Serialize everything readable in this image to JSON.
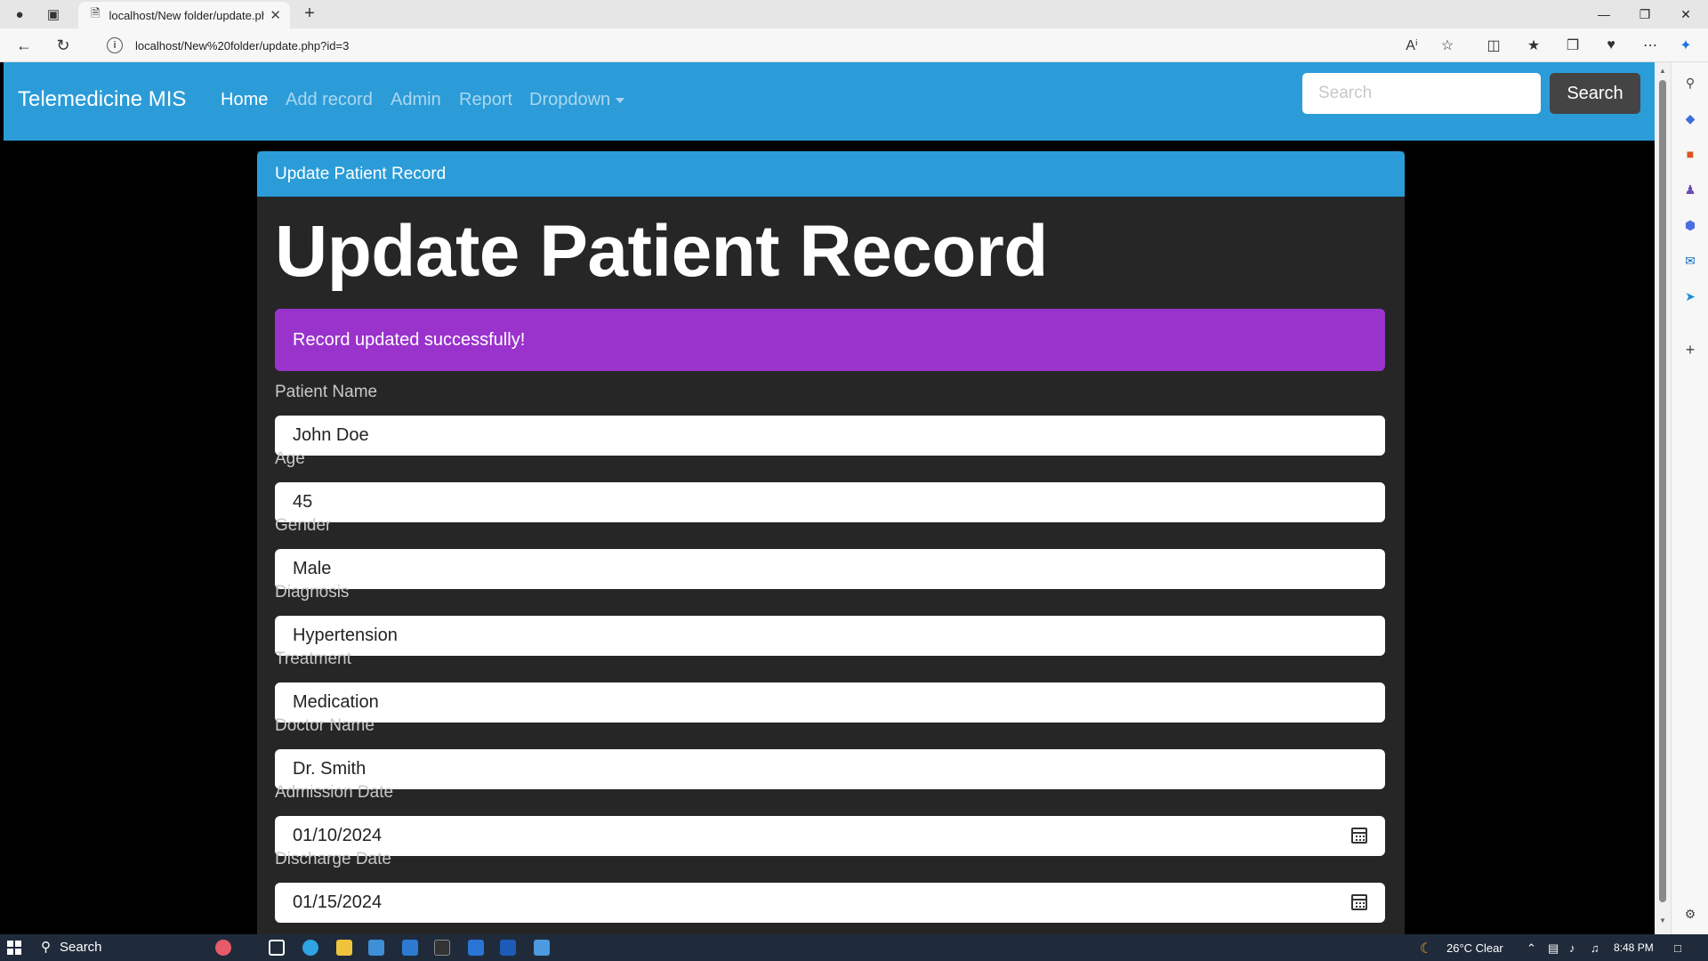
{
  "browser": {
    "tab_title": "localhost/New folder/update.php",
    "url": "localhost/New%20folder/update.php?id=3"
  },
  "navbar": {
    "brand": "Telemedicine MIS",
    "links": [
      "Home",
      "Add record",
      "Admin",
      "Report",
      "Dropdown"
    ],
    "search_placeholder": "Search",
    "search_button": "Search"
  },
  "card": {
    "header": "Update Patient Record",
    "title": "Update Patient Record",
    "alert": "Record updated successfully!"
  },
  "form": {
    "fields": [
      {
        "label": "Patient Name",
        "value": "John Doe"
      },
      {
        "label": "Age",
        "value": "45"
      },
      {
        "label": "Gender",
        "value": "Male"
      },
      {
        "label": "Diagnosis",
        "value": "Hypertension"
      },
      {
        "label": "Treatment",
        "value": "Medication"
      },
      {
        "label": "Doctor Name",
        "value": "Dr. Smith"
      },
      {
        "label": "Admission Date",
        "value": "01/10/2024"
      },
      {
        "label": "Discharge Date",
        "value": "01/15/2024"
      }
    ]
  },
  "taskbar": {
    "search": "Search",
    "weather": "26°C Clear",
    "time": "8:48 PM"
  },
  "colors": {
    "navbar": "#2b9cd8",
    "card": "#262626",
    "alert": "#9a32cc",
    "search_button": "#444444"
  }
}
